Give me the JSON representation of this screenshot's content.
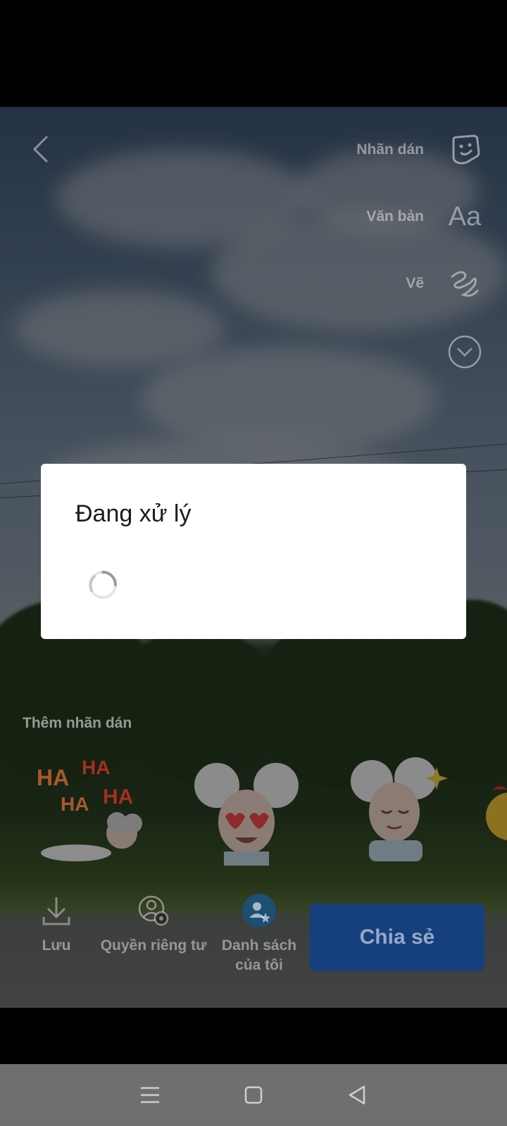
{
  "editor": {
    "tools": [
      {
        "label": "Nhãn dán",
        "icon": "sticker-icon"
      },
      {
        "label": "Văn bản",
        "icon": "text-aa-icon",
        "glyph": "Aa"
      },
      {
        "label": "Vẽ",
        "icon": "draw-squiggle-icon"
      }
    ],
    "more_icon": "chevron-down-circle-icon",
    "back_icon": "back-arrow-icon",
    "add_sticker_label": "Thêm nhãn dán",
    "sticker_text": {
      "ha": "HA"
    }
  },
  "actions": {
    "save_label": "Lưu",
    "privacy_label": "Quyền riêng tư",
    "my_list_label_line1": "Danh sách",
    "my_list_label_line2": "của tôi",
    "share_label": "Chia sẻ"
  },
  "dialog": {
    "title": "Đang xử lý"
  },
  "colors": {
    "share_button": "#153f7d",
    "navbar": "#6f6f6f",
    "dialog_bg": "#ffffff"
  }
}
